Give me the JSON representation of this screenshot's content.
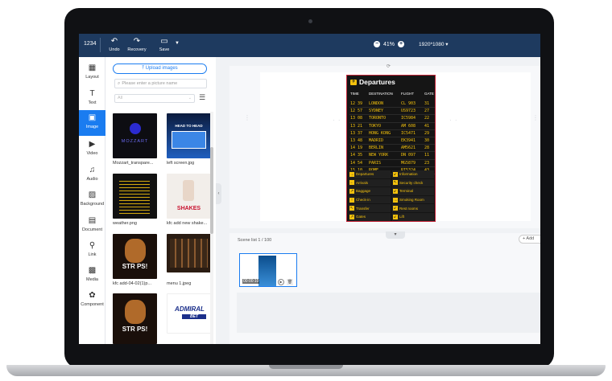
{
  "toolbar": {
    "project_number": "1234",
    "undo_label": "Undo",
    "recovery_label": "Recovery",
    "save_label": "Save",
    "zoom_value": "41%",
    "resolution": "1920*1080"
  },
  "sidebar": {
    "items": [
      {
        "label": "Layout",
        "icon": "layout-icon"
      },
      {
        "label": "Text",
        "icon": "text-icon"
      },
      {
        "label": "Image",
        "icon": "image-icon"
      },
      {
        "label": "Video",
        "icon": "video-icon"
      },
      {
        "label": "Audio",
        "icon": "audio-icon"
      },
      {
        "label": "Background",
        "icon": "background-icon"
      },
      {
        "label": "Document",
        "icon": "document-icon"
      },
      {
        "label": "Link",
        "icon": "link-icon"
      },
      {
        "label": "Media",
        "icon": "media-icon"
      },
      {
        "label": "Component",
        "icon": "component-icon"
      }
    ],
    "active": "Image"
  },
  "panel": {
    "upload_label": "Upload images",
    "search_placeholder": "Please enter a picture name",
    "filter_value": "All",
    "images": [
      {
        "caption": "Mozzart_transpare..."
      },
      {
        "caption": "left screen.jpg"
      },
      {
        "caption": "weather.png"
      },
      {
        "caption": "kfc add new shake..."
      },
      {
        "caption": "kfc add-04-02(1)p..."
      },
      {
        "caption": "menu 1.jpeg"
      },
      {
        "caption": ""
      },
      {
        "caption": ""
      }
    ],
    "thumb_text": {
      "mozzart": "MOZZART",
      "head_to_head": "HEAD TO HEAD",
      "shakes": "SHAKES",
      "strips": "STR PS!",
      "admiral": "ADMIRAL",
      "bet": "BET"
    }
  },
  "board": {
    "title": "Departures",
    "headers": [
      "TIME",
      "DESTINATION",
      "FLIGHT",
      "GATE"
    ],
    "rows": [
      [
        "12 39",
        "LONDON",
        "CL 903",
        "31"
      ],
      [
        "12 57",
        "SYDNEY",
        "US9723",
        "27"
      ],
      [
        "13 08",
        "TORONTO",
        "IC5984",
        "22"
      ],
      [
        "13 21",
        "TOKYO",
        "AM 608",
        "41"
      ],
      [
        "13 37",
        "HONG KONG",
        "IC5471",
        "29"
      ],
      [
        "13 48",
        "MADRID",
        "EK3941",
        "30"
      ],
      [
        "14 19",
        "BERLIN",
        "AM5621",
        "28"
      ],
      [
        "14 35",
        "NEW YORK",
        "DN 097",
        "11"
      ],
      [
        "14 54",
        "PARIS",
        "MG5879",
        "23"
      ],
      [
        "15 10",
        "ROME",
        "RI5324",
        "43"
      ]
    ],
    "services": [
      {
        "label": "Departures",
        "arrow": "→"
      },
      {
        "label": "Information",
        "arrow": "↙"
      },
      {
        "label": "Arrivals",
        "arrow": "←"
      },
      {
        "label": "Security check",
        "arrow": "↖"
      },
      {
        "label": "Baggage",
        "arrow": "↗"
      },
      {
        "label": "Terminal",
        "arrow": "↙"
      },
      {
        "label": "Check-in",
        "arrow": "↑"
      },
      {
        "label": "Smoking Room",
        "arrow": "→"
      },
      {
        "label": "Transfer",
        "arrow": "↖"
      },
      {
        "label": "Rest rooms",
        "arrow": "↙"
      },
      {
        "label": "Gates",
        "arrow": "↗"
      },
      {
        "label": "Lift",
        "arrow": "↙"
      }
    ]
  },
  "scenes": {
    "label": "Scene list 1 / 100",
    "add_label": "+ Add",
    "time": "00:00:10"
  },
  "colors": {
    "toolbar_bg": "#1e3a5f",
    "accent": "#1a7cf0",
    "board_yellow": "#f4c20d",
    "selection_red": "#c4263a"
  }
}
